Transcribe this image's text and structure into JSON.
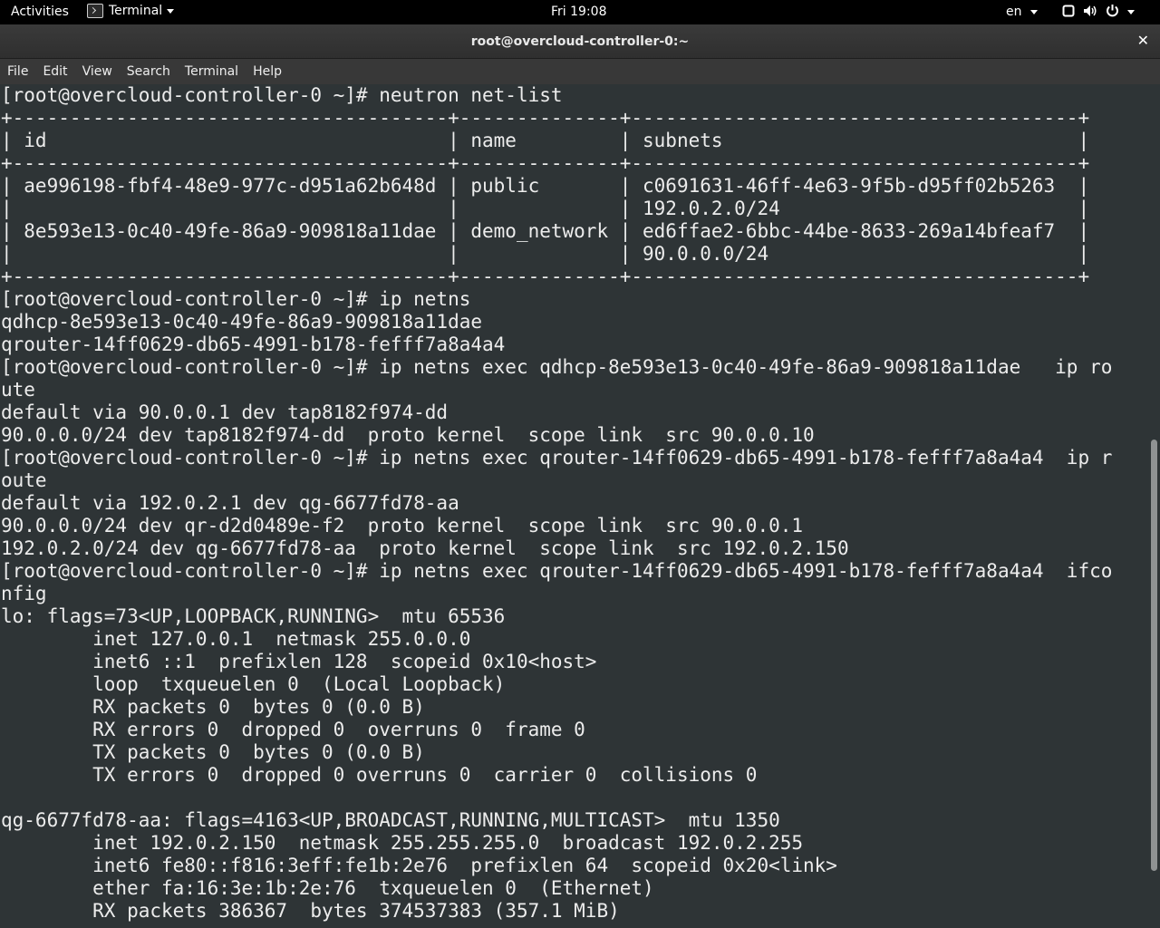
{
  "topbar": {
    "activities": "Activities",
    "app_name": "Terminal",
    "clock": "Fri 19:08",
    "language": "en",
    "icons": [
      "window-icon",
      "volume-icon",
      "power-icon"
    ]
  },
  "window": {
    "title": "root@overcloud-controller-0:~",
    "close_glyph": "✕"
  },
  "menubar": {
    "items": [
      "File",
      "Edit",
      "View",
      "Search",
      "Terminal",
      "Help"
    ]
  },
  "terminal": {
    "lines": [
      "[root@overcloud-controller-0 ~]# neutron net-list",
      "+--------------------------------------+--------------+---------------------------------------+",
      "| id                                   | name         | subnets                               |",
      "+--------------------------------------+--------------+---------------------------------------+",
      "| ae996198-fbf4-48e9-977c-d951a62b648d | public       | c0691631-46ff-4e63-9f5b-d95ff02b5263  |",
      "|                                      |              | 192.0.2.0/24                          |",
      "| 8e593e13-0c40-49fe-86a9-909818a11dae | demo_network | ed6ffae2-6bbc-44be-8633-269a14bfeaf7  |",
      "|                                      |              | 90.0.0.0/24                           |",
      "+--------------------------------------+--------------+---------------------------------------+",
      "[root@overcloud-controller-0 ~]# ip netns",
      "qdhcp-8e593e13-0c40-49fe-86a9-909818a11dae",
      "qrouter-14ff0629-db65-4991-b178-fefff7a8a4a4",
      "[root@overcloud-controller-0 ~]# ip netns exec qdhcp-8e593e13-0c40-49fe-86a9-909818a11dae   ip ro",
      "ute",
      "default via 90.0.0.1 dev tap8182f974-dd",
      "90.0.0.0/24 dev tap8182f974-dd  proto kernel  scope link  src 90.0.0.10",
      "[root@overcloud-controller-0 ~]# ip netns exec qrouter-14ff0629-db65-4991-b178-fefff7a8a4a4  ip r",
      "oute",
      "default via 192.0.2.1 dev qg-6677fd78-aa",
      "90.0.0.0/24 dev qr-d2d0489e-f2  proto kernel  scope link  src 90.0.0.1",
      "192.0.2.0/24 dev qg-6677fd78-aa  proto kernel  scope link  src 192.0.2.150",
      "[root@overcloud-controller-0 ~]# ip netns exec qrouter-14ff0629-db65-4991-b178-fefff7a8a4a4  ifco",
      "nfig",
      "lo: flags=73<UP,LOOPBACK,RUNNING>  mtu 65536",
      "        inet 127.0.0.1  netmask 255.0.0.0",
      "        inet6 ::1  prefixlen 128  scopeid 0x10<host>",
      "        loop  txqueuelen 0  (Local Loopback)",
      "        RX packets 0  bytes 0 (0.0 B)",
      "        RX errors 0  dropped 0  overruns 0  frame 0",
      "        TX packets 0  bytes 0 (0.0 B)",
      "        TX errors 0  dropped 0 overruns 0  carrier 0  collisions 0",
      "",
      "qg-6677fd78-aa: flags=4163<UP,BROADCAST,RUNNING,MULTICAST>  mtu 1350",
      "        inet 192.0.2.150  netmask 255.255.255.0  broadcast 192.0.2.255",
      "        inet6 fe80::f816:3eff:fe1b:2e76  prefixlen 64  scopeid 0x20<link>",
      "        ether fa:16:3e:1b:2e:76  txqueuelen 0  (Ethernet)",
      "        RX packets 386367  bytes 374537383 (357.1 MiB)"
    ]
  }
}
